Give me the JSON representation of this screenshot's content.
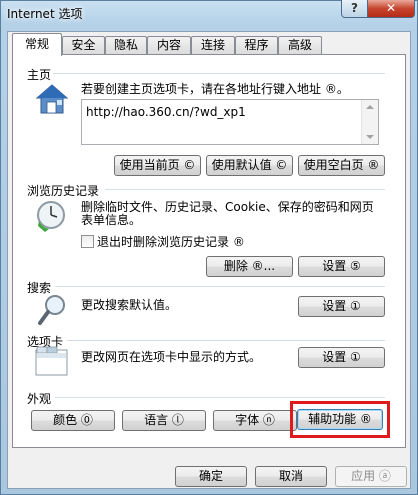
{
  "window": {
    "title": "Internet 选项",
    "help_glyph": "?",
    "close_glyph": "✕"
  },
  "tabs": [
    "常规",
    "安全",
    "隐私",
    "内容",
    "连接",
    "程序",
    "高级"
  ],
  "active_tab": "常规",
  "homepage": {
    "label": "主页",
    "instruction": "若要创建主页选项卡，请在各地址行键入地址 ®。",
    "address_value": "http://hao.360.cn/?wd_xp1",
    "use_current": "使用当前页 ©",
    "use_default": "使用默认值 ©",
    "use_blank": "使用空白页 ®",
    "icon": "house-icon"
  },
  "history": {
    "label": "浏览历史记录",
    "description_line1": "删除临时文件、历史记录、Cookie、保存的密码和网页",
    "description_line2": "表单信息。",
    "checkbox_label": "退出时删除浏览历史记录 ®",
    "checkbox_checked": false,
    "delete_label": "删除 ®...",
    "settings_label": "设置 ⑤",
    "icon": "clock-icon"
  },
  "search": {
    "label": "搜索",
    "description": "更改搜索默认值。",
    "settings_label": "设置 ①",
    "icon": "magnifier-icon"
  },
  "tabs_section": {
    "label": "选项卡",
    "description": "更改网页在选项卡中显示的方式。",
    "settings_label": "设置 ①",
    "icon": "tabs-window-icon"
  },
  "appearance": {
    "label": "外观",
    "colors": "颜色 ⓪",
    "languages": "语言 ⓛ",
    "fonts": "字体 ⓝ",
    "accessibility": "辅助功能 ®"
  },
  "footer": {
    "ok": "确定",
    "cancel": "取消",
    "apply": "应用 ⓐ"
  },
  "colors": {
    "highlight": "#e01a1a",
    "close_button": "#c7452f"
  }
}
